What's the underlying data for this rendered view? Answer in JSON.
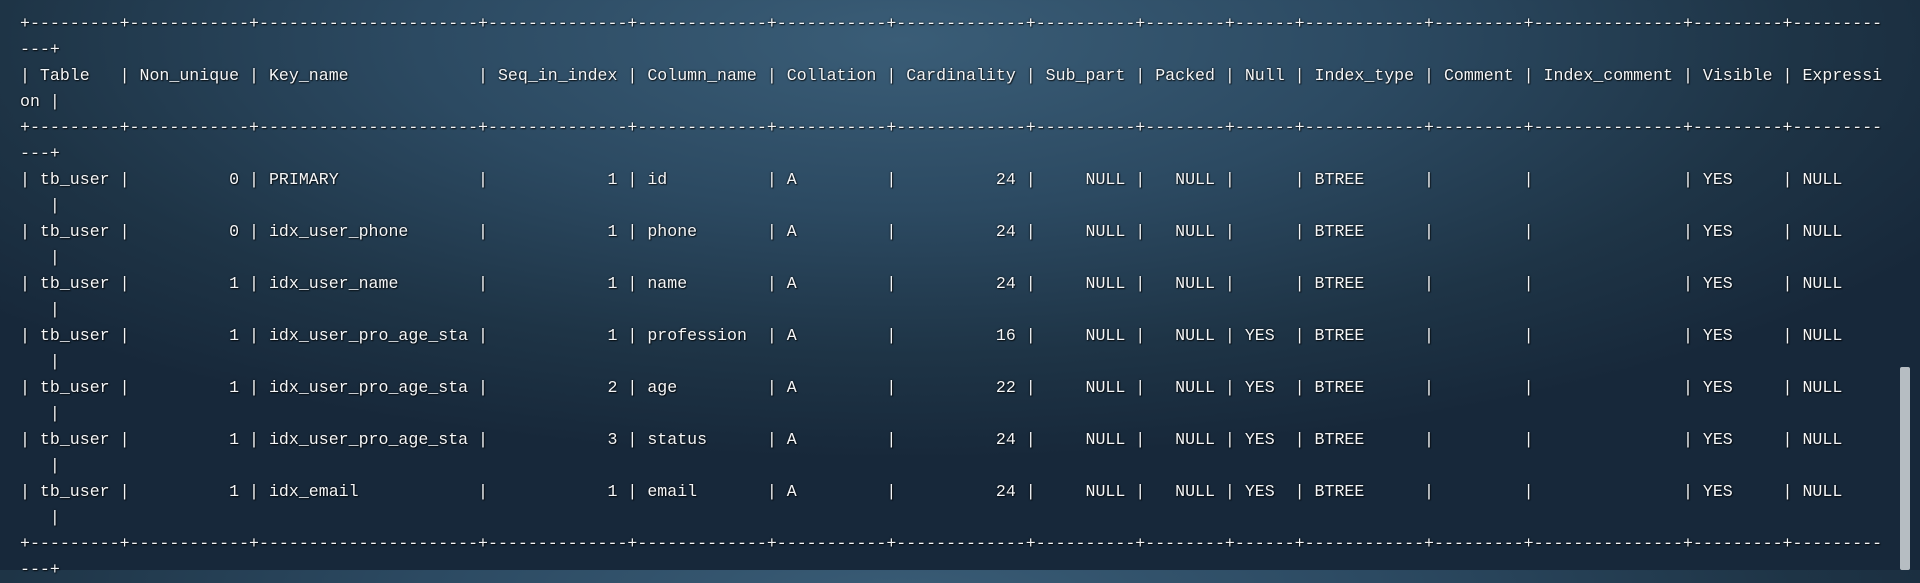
{
  "terminal": {
    "wrap_columns": 187,
    "columns": [
      {
        "name": "Table",
        "width": 7,
        "align": "left"
      },
      {
        "name": "Non_unique",
        "width": 10,
        "align": "right"
      },
      {
        "name": "Key_name",
        "width": 20,
        "align": "left"
      },
      {
        "name": "Seq_in_index",
        "width": 12,
        "align": "right"
      },
      {
        "name": "Column_name",
        "width": 11,
        "align": "left"
      },
      {
        "name": "Collation",
        "width": 9,
        "align": "left"
      },
      {
        "name": "Cardinality",
        "width": 11,
        "align": "right"
      },
      {
        "name": "Sub_part",
        "width": 8,
        "align": "right"
      },
      {
        "name": "Packed",
        "width": 6,
        "align": "right"
      },
      {
        "name": "Null",
        "width": 4,
        "align": "left"
      },
      {
        "name": "Index_type",
        "width": 10,
        "align": "left"
      },
      {
        "name": "Comment",
        "width": 7,
        "align": "left"
      },
      {
        "name": "Index_comment",
        "width": 13,
        "align": "left"
      },
      {
        "name": "Visible",
        "width": 7,
        "align": "left"
      },
      {
        "name": "Expression",
        "width": 10,
        "align": "left"
      }
    ],
    "rows": [
      [
        "tb_user",
        "0",
        "PRIMARY",
        "1",
        "id",
        "A",
        "24",
        "NULL",
        "NULL",
        "",
        "BTREE",
        "",
        "",
        "YES",
        "NULL"
      ],
      [
        "tb_user",
        "0",
        "idx_user_phone",
        "1",
        "phone",
        "A",
        "24",
        "NULL",
        "NULL",
        "",
        "BTREE",
        "",
        "",
        "YES",
        "NULL"
      ],
      [
        "tb_user",
        "1",
        "idx_user_name",
        "1",
        "name",
        "A",
        "24",
        "NULL",
        "NULL",
        "",
        "BTREE",
        "",
        "",
        "YES",
        "NULL"
      ],
      [
        "tb_user",
        "1",
        "idx_user_pro_age_sta",
        "1",
        "profession",
        "A",
        "16",
        "NULL",
        "NULL",
        "YES",
        "BTREE",
        "",
        "",
        "YES",
        "NULL"
      ],
      [
        "tb_user",
        "1",
        "idx_user_pro_age_sta",
        "2",
        "age",
        "A",
        "22",
        "NULL",
        "NULL",
        "YES",
        "BTREE",
        "",
        "",
        "YES",
        "NULL"
      ],
      [
        "tb_user",
        "1",
        "idx_user_pro_age_sta",
        "3",
        "status",
        "A",
        "24",
        "NULL",
        "NULL",
        "YES",
        "BTREE",
        "",
        "",
        "YES",
        "NULL"
      ],
      [
        "tb_user",
        "1",
        "idx_email",
        "1",
        "email",
        "A",
        "24",
        "NULL",
        "NULL",
        "YES",
        "BTREE",
        "",
        "",
        "YES",
        "NULL"
      ]
    ]
  }
}
